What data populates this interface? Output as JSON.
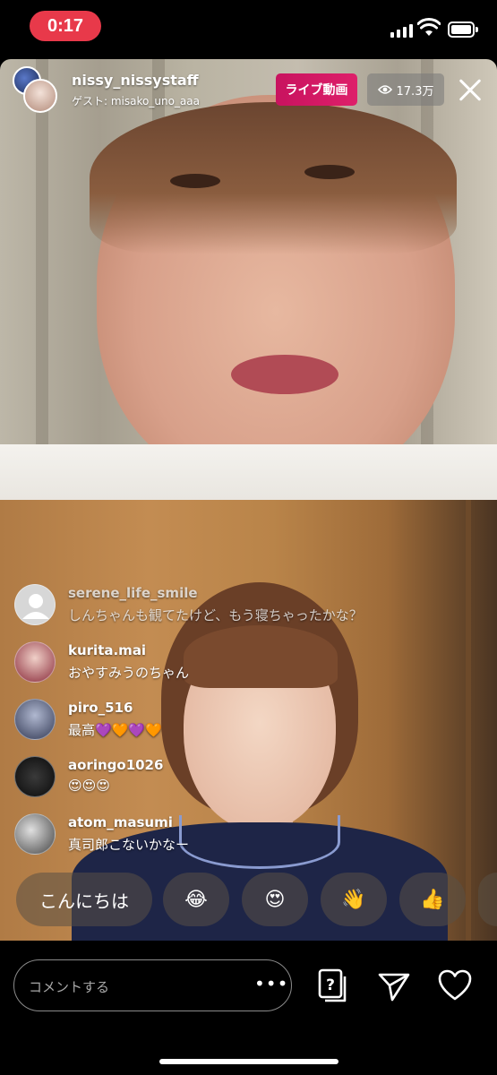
{
  "status_bar": {
    "time": "0:17",
    "icons": [
      "signal-icon",
      "wifi-icon",
      "battery-icon"
    ]
  },
  "live": {
    "host_username": "nissy_nissystaff",
    "guest_prefix": "ゲスト: ",
    "guest_username": "misako_uno_aaa",
    "live_badge": "ライブ動画",
    "viewer_count": "17.3万",
    "close_icon": "close-icon"
  },
  "comments": [
    {
      "user": "serene_life_smile",
      "text": "しんちゃんも観てたけど、もう寝ちゃったかな？",
      "muted": true
    },
    {
      "user": "kurita.mai",
      "text": "おやすみうのちゃん",
      "muted": false
    },
    {
      "user": "piro_516",
      "text": "最高💜🧡💜🧡",
      "muted": false
    },
    {
      "user": "aoringo1026",
      "text": "😍😍😍",
      "muted": false
    },
    {
      "user": "atom_masumi",
      "text": "真司郎こないかなー",
      "muted": false
    }
  ],
  "quick_replies": [
    "こんにちは",
    "😂",
    "😍",
    "👋",
    "👍"
  ],
  "bottom_bar": {
    "comment_placeholder": "コメントする",
    "more_label": "•••",
    "icons": [
      "question-card-icon",
      "send-icon",
      "heart-icon"
    ]
  },
  "colors": {
    "time_pill": "#e8394a",
    "live_badge": "#d4185f",
    "background": "#000000"
  }
}
